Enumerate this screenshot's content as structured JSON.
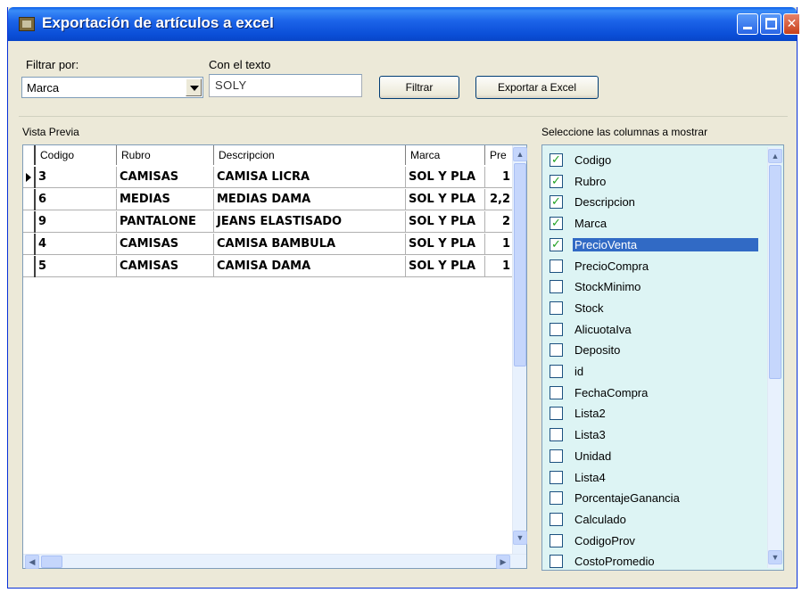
{
  "window": {
    "title": "Exportación de artículos a excel"
  },
  "filter": {
    "filter_by_label": "Filtrar por:",
    "field_value": "Marca",
    "text_label": "Con el texto",
    "text_value": "SOLY",
    "filter_button": "Filtrar",
    "export_button": "Exportar a Excel"
  },
  "preview": {
    "label": "Vista Previa",
    "columns": [
      "Codigo",
      "Rubro",
      "Descripcion",
      "Marca",
      "Pre"
    ],
    "rows": [
      [
        "3",
        "CAMISAS",
        "CAMISA LICRA",
        "SOL Y PLA",
        "1"
      ],
      [
        "6",
        "MEDIAS",
        "MEDIAS DAMA",
        "SOL Y PLA",
        "2,2"
      ],
      [
        "9",
        "PANTALONE",
        "JEANS ELASTISADO",
        "SOL Y PLA",
        "2"
      ],
      [
        "4",
        "CAMISAS",
        "CAMISA BAMBULA",
        "SOL Y PLA",
        "1"
      ],
      [
        "5",
        "CAMISAS",
        "CAMISA DAMA",
        "SOL Y PLA",
        "1"
      ]
    ]
  },
  "columns_panel": {
    "label": "Seleccione las columnas a mostrar",
    "items": [
      {
        "label": "Codigo",
        "checked": true
      },
      {
        "label": "Rubro",
        "checked": true
      },
      {
        "label": "Descripcion",
        "checked": true
      },
      {
        "label": "Marca",
        "checked": true
      },
      {
        "label": "PrecioVenta",
        "checked": true
      },
      {
        "label": "PrecioCompra",
        "checked": false
      },
      {
        "label": "StockMinimo",
        "checked": false
      },
      {
        "label": "Stock",
        "checked": false
      },
      {
        "label": "AlicuotaIva",
        "checked": false
      },
      {
        "label": "Deposito",
        "checked": false
      },
      {
        "label": "id",
        "checked": false
      },
      {
        "label": "FechaCompra",
        "checked": false
      },
      {
        "label": "Lista2",
        "checked": false
      },
      {
        "label": "Lista3",
        "checked": false
      },
      {
        "label": "Unidad",
        "checked": false
      },
      {
        "label": "Lista4",
        "checked": false
      },
      {
        "label": "PorcentajeGanancia",
        "checked": false
      },
      {
        "label": "Calculado",
        "checked": false
      },
      {
        "label": "CodigoProv",
        "checked": false
      },
      {
        "label": "CostoPromedio",
        "checked": false
      }
    ]
  }
}
